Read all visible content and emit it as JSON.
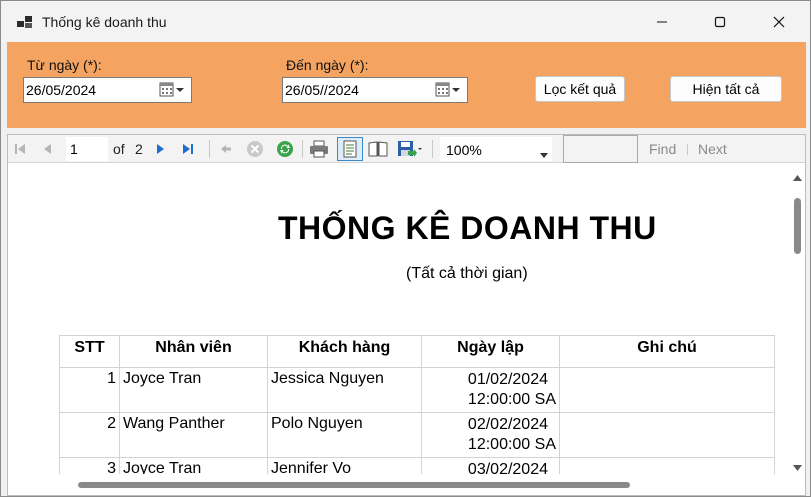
{
  "window": {
    "title": "Thống kê doanh thu"
  },
  "filter": {
    "from_label": "Từ ngày (*):",
    "from_value": "26/05/2024",
    "to_label": "Đến ngày (*):",
    "to_value": "26/05//2024",
    "filter_button": "Lọc kết quả",
    "show_all_button": "Hiện tất cả",
    "panel_color": "#f4a460"
  },
  "toolbar": {
    "current_page": "1",
    "of_label": "of",
    "total_pages": "2",
    "zoom": "100%",
    "find_label": "Find",
    "next_label": "Next",
    "icons": [
      "first-page-icon",
      "prev-page-icon",
      "next-page-icon",
      "last-page-icon",
      "back-icon",
      "stop-icon",
      "refresh-icon",
      "print-icon",
      "print-layout-icon",
      "page-setup-icon",
      "export-icon"
    ]
  },
  "report": {
    "title": "THỐNG KÊ DOANH THU",
    "subtitle": "(Tất cả thời gian)",
    "columns": [
      "STT",
      "Nhân viên",
      "Khách hàng",
      "Ngày lập",
      "Ghi chú"
    ],
    "rows": [
      {
        "stt": "1",
        "employee": "Joyce Tran",
        "customer": "Jessica Nguyen",
        "date": "01/02/2024",
        "time": "12:00:00 SA",
        "note": ""
      },
      {
        "stt": "2",
        "employee": "Wang Panther",
        "customer": "Polo Nguyen",
        "date": "02/02/2024",
        "time": "12:00:00 SA",
        "note": ""
      },
      {
        "stt": "3",
        "employee": "Joyce Tran",
        "customer": "Jennifer Vo",
        "date": "03/02/2024",
        "time": "",
        "note": ""
      }
    ]
  }
}
